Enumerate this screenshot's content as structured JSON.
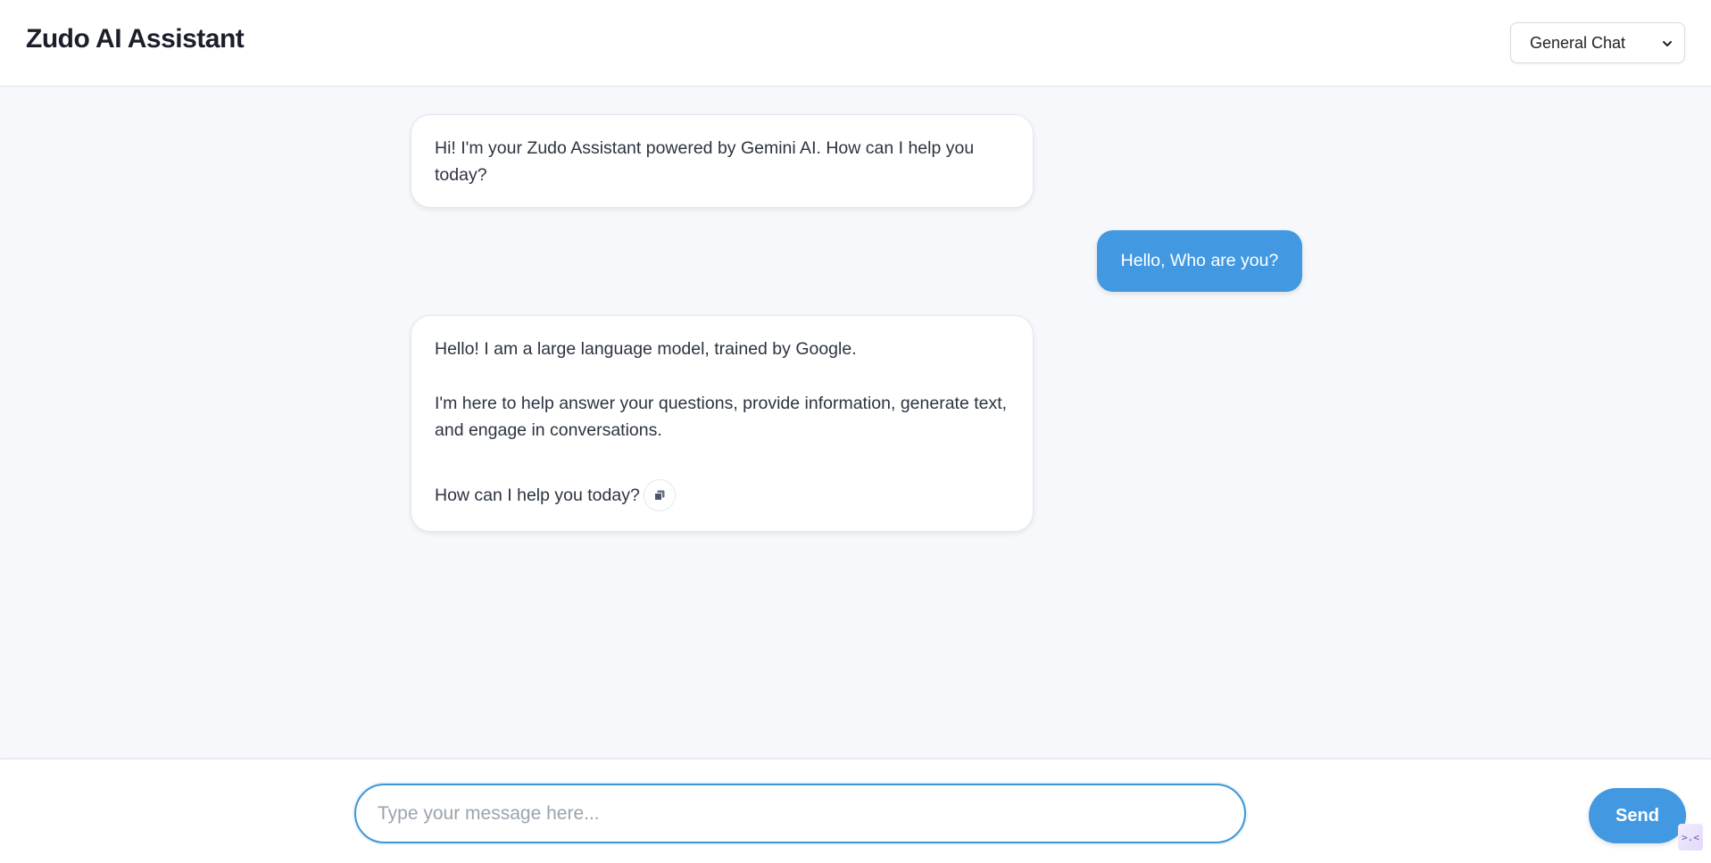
{
  "header": {
    "title": "Zudo AI Assistant",
    "mode_select": {
      "selected": "General Chat"
    }
  },
  "messages": [
    {
      "role": "assistant",
      "paragraphs": [
        "Hi! I'm your Zudo Assistant powered by Gemini AI. How can I help you today?"
      ]
    },
    {
      "role": "user",
      "text": "Hello, Who are you?"
    },
    {
      "role": "assistant",
      "paragraphs": [
        "Hello! I am a large language model, trained by Google.",
        "I'm here to help answer your questions, provide information, generate text, and engage in conversations.",
        "How can I help you today?"
      ],
      "actions": [
        "copy-icon"
      ]
    }
  ],
  "composer": {
    "placeholder": "Type your message here...",
    "value": "",
    "send_label": "Send"
  },
  "corner_widget": {
    "glyph": ">.<",
    "icon": "extension-icon"
  },
  "colors": {
    "accent": "#4299e1",
    "background": "#f6f8fb",
    "text": "#2c3440"
  }
}
